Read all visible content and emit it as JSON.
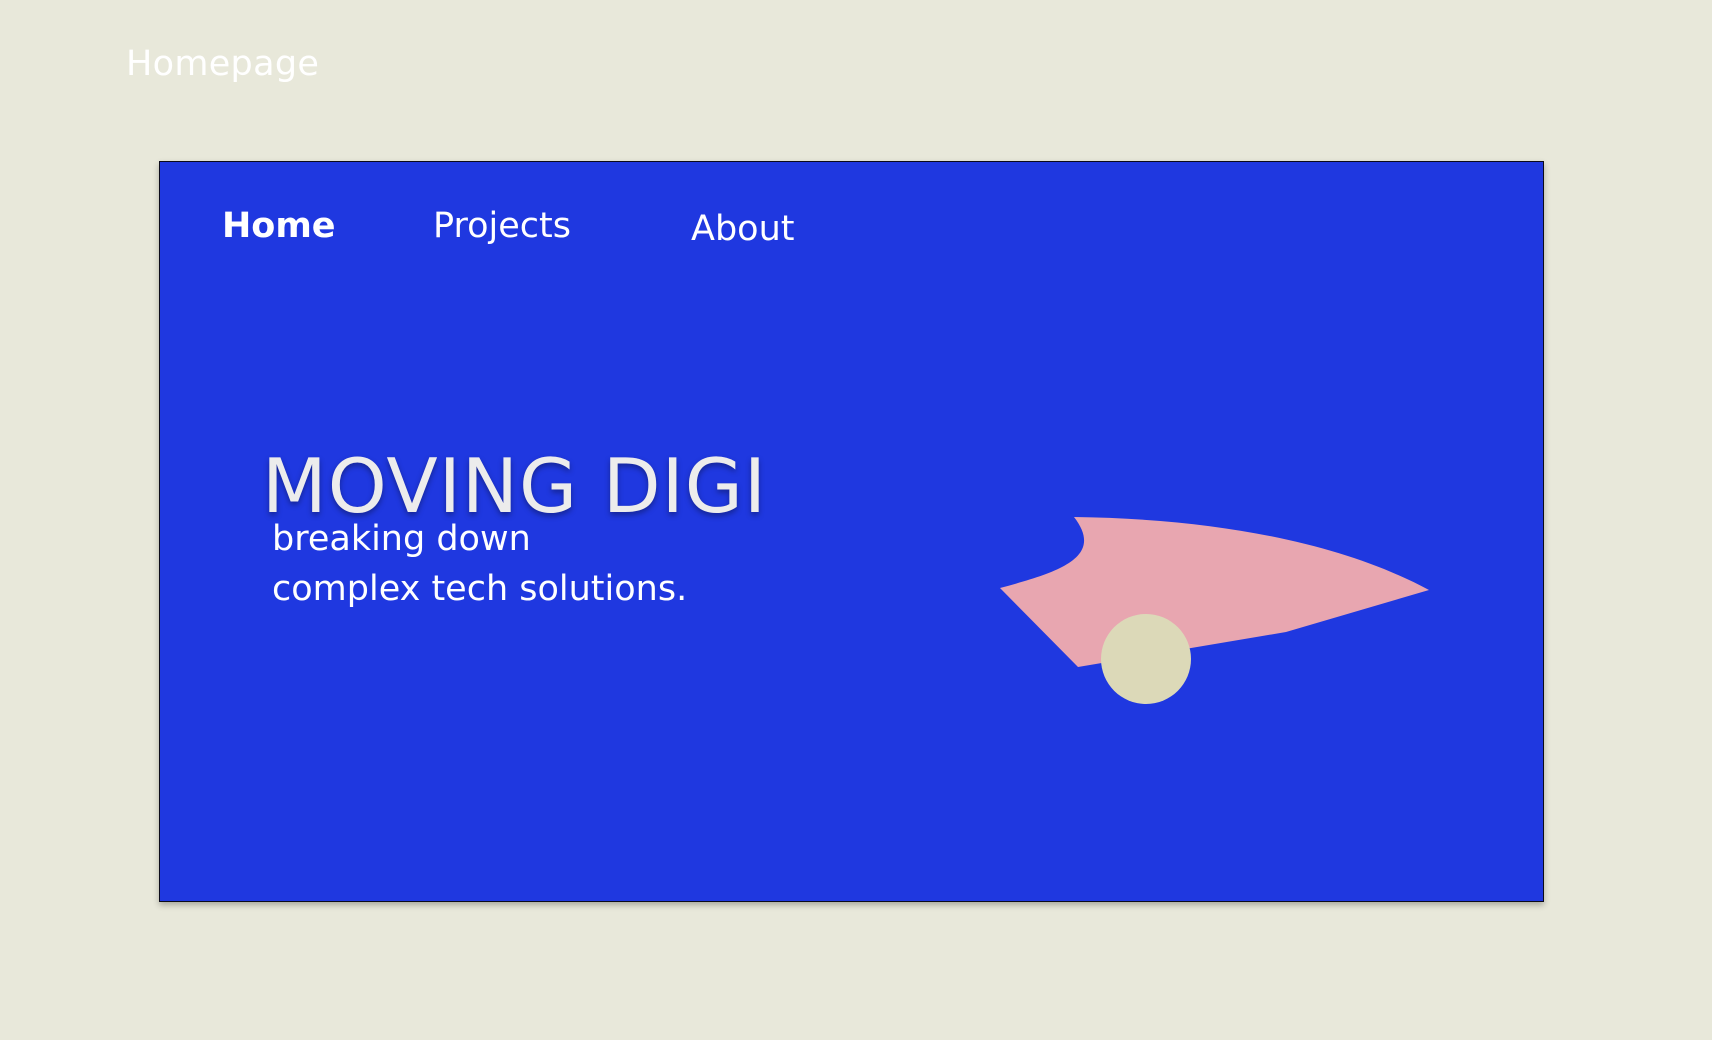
{
  "canvas": {
    "frame_label": "Homepage"
  },
  "nav": {
    "items": [
      {
        "label": "Home",
        "active": true
      },
      {
        "label": "Projects",
        "active": false
      },
      {
        "label": "About",
        "active": false
      }
    ]
  },
  "hero": {
    "title": "MOVING DIGI",
    "subtitle_line1": "breaking down",
    "subtitle_line2": "complex tech solutions."
  },
  "colors": {
    "page_background": "#e8e8da",
    "frame_background": "#1f38e0",
    "shape_pink": "#e8a6b0",
    "shape_circle": "#dcd9b8",
    "text": "#ffffff"
  }
}
